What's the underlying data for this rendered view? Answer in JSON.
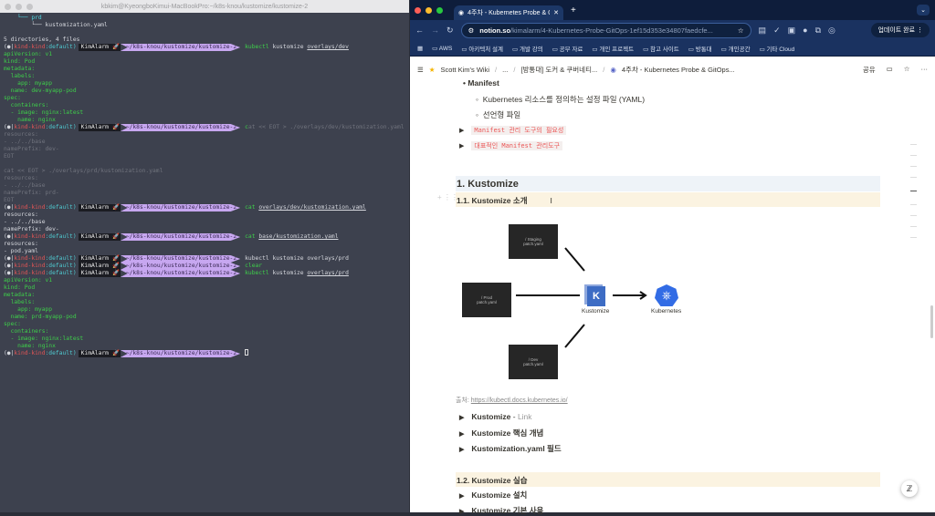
{
  "terminal": {
    "title": "kbkim@KyeongboKimui-MacBookPro:~/k8s-knou/kustomize/kustomize-2",
    "prompt": {
      "open": "(●|",
      "context": "kind-kind",
      "ns": ":default)",
      "user": "KimAlarm",
      "rocket": "🚀",
      "path": "~/k8s-knou/kustomize/kustomize-2"
    },
    "lines": [
      {
        "t": "    └── prd",
        "c": "cy"
      },
      {
        "t": "        └── kustomization.yaml"
      },
      {
        "t": ""
      },
      {
        "t": "5 directories, 4 files"
      },
      {
        "p": true,
        "cmd": "kubectl",
        "args": " kustomize ",
        "u": "overlays/dev"
      },
      {
        "t": "apiVersion: v1",
        "c": "g"
      },
      {
        "t": "kind: Pod",
        "c": "g"
      },
      {
        "t": "metadata:",
        "c": "g"
      },
      {
        "t": "  labels:",
        "c": "g"
      },
      {
        "t": "    app: myapp",
        "c": "g"
      },
      {
        "t": "  name: dev-myapp-pod",
        "c": "g"
      },
      {
        "t": "spec:",
        "c": "g"
      },
      {
        "t": "  containers:",
        "c": "g"
      },
      {
        "t": "  - image: nginx:latest",
        "c": "g"
      },
      {
        "t": "    name: nginx",
        "c": "g"
      },
      {
        "p": true,
        "cmd": "c",
        "args": "",
        "rest": "at << EOT > ./overlays/dev/kustomization.yaml"
      },
      {
        "t": "resources:",
        "c": "dim"
      },
      {
        "t": "- ../../base",
        "c": "dim"
      },
      {
        "t": "namePrefix: dev-",
        "c": "dim"
      },
      {
        "t": "EOT",
        "c": "dim"
      },
      {
        "t": ""
      },
      {
        "t": "cat << EOT > ./overlays/prd/kustomization.yaml",
        "c": "dim"
      },
      {
        "t": "resources:",
        "c": "dim"
      },
      {
        "t": "- ../../base",
        "c": "dim"
      },
      {
        "t": "namePrefix: prd-",
        "c": "dim"
      },
      {
        "t": "EOT",
        "c": "dim"
      },
      {
        "p": true,
        "cmd": "cat",
        "args": " ",
        "u": "overlays/dev/kustomization.yaml"
      },
      {
        "t": "resources:"
      },
      {
        "t": "- ../../base"
      },
      {
        "t": "namePrefix: dev-"
      },
      {
        "p": true,
        "cmd": "cat",
        "args": " ",
        "u": "base/kustomization.yaml"
      },
      {
        "t": "resources:"
      },
      {
        "t": "- pod.yaml"
      },
      {
        "p": true,
        "plain": "kubectl kustomize overlays/prd"
      },
      {
        "p": true,
        "cmd": "clear",
        "args": ""
      },
      {
        "p": true,
        "cmd": "kubectl",
        "args": " kustomize ",
        "u": "overlays/prd"
      },
      {
        "t": "apiVersion: v1",
        "c": "g"
      },
      {
        "t": "kind: Pod",
        "c": "g"
      },
      {
        "t": "metadata:",
        "c": "g"
      },
      {
        "t": "  labels:",
        "c": "g"
      },
      {
        "t": "    app: myapp",
        "c": "g"
      },
      {
        "t": "  name: prd-myapp-pod",
        "c": "g"
      },
      {
        "t": "spec:",
        "c": "g"
      },
      {
        "t": "  containers:",
        "c": "g"
      },
      {
        "t": "  - image: nginx:latest",
        "c": "g"
      },
      {
        "t": "    name: nginx",
        "c": "g"
      },
      {
        "p": true,
        "cursor": true
      }
    ]
  },
  "browser": {
    "tab_title": "4주차 - Kubernetes Probe & G",
    "url_host": "notion.so",
    "url_rest": "/kimalarm/4-Kubernetes-Probe-GitOps-1ef15d353e34807faedcfe...",
    "update_label": "업데이트 완료",
    "bookmarks": [
      "AWS",
      "아키텍처 설계",
      "개발 강의",
      "공부 자료",
      "개인 프로젝트",
      "참고 사이트",
      "방통대",
      "개인공간",
      "기타 Cloud"
    ]
  },
  "notion": {
    "breadcrumb": [
      "Scott Kim's Wiki",
      "...",
      "[방통대] 도커 & 쿠버네티...",
      "4주차 - Kubernetes Probe & GitOps..."
    ],
    "share": "공유",
    "bullet": "Manifest",
    "sub_bullets": [
      "Kubernetes 리소스를 정의하는 설정 파일 (YAML)",
      "선언형 파일"
    ],
    "toggles_code": [
      "Manifest 관리 도구의 필요성",
      "대표적인 Manifest 관리도구"
    ],
    "h1": "1. Kustomize",
    "h2a": "1.1. Kustomize 소개",
    "diagram": {
      "staging": "/ Staging\npatch.yaml",
      "prod": "/ Prod\npatch.yaml",
      "dev": "/ Dev\npatch.yaml",
      "kustomize": "Kustomize",
      "kubernetes": "Kubernetes",
      "k": "K"
    },
    "source_label": "출처:",
    "source_url": "https://kubectl.docs.kubernetes.io/",
    "toggles": [
      {
        "label": "Kustomize",
        "sep": " - ",
        "link": "Link"
      },
      {
        "label": "Kustomize 핵심 개념"
      },
      {
        "label": "Kustomization.yaml 필드"
      }
    ],
    "h2b": "1.2. Kustomize 실습",
    "toggles2": [
      "Kustomize 설치",
      "Kustomize 기본 사용"
    ]
  }
}
